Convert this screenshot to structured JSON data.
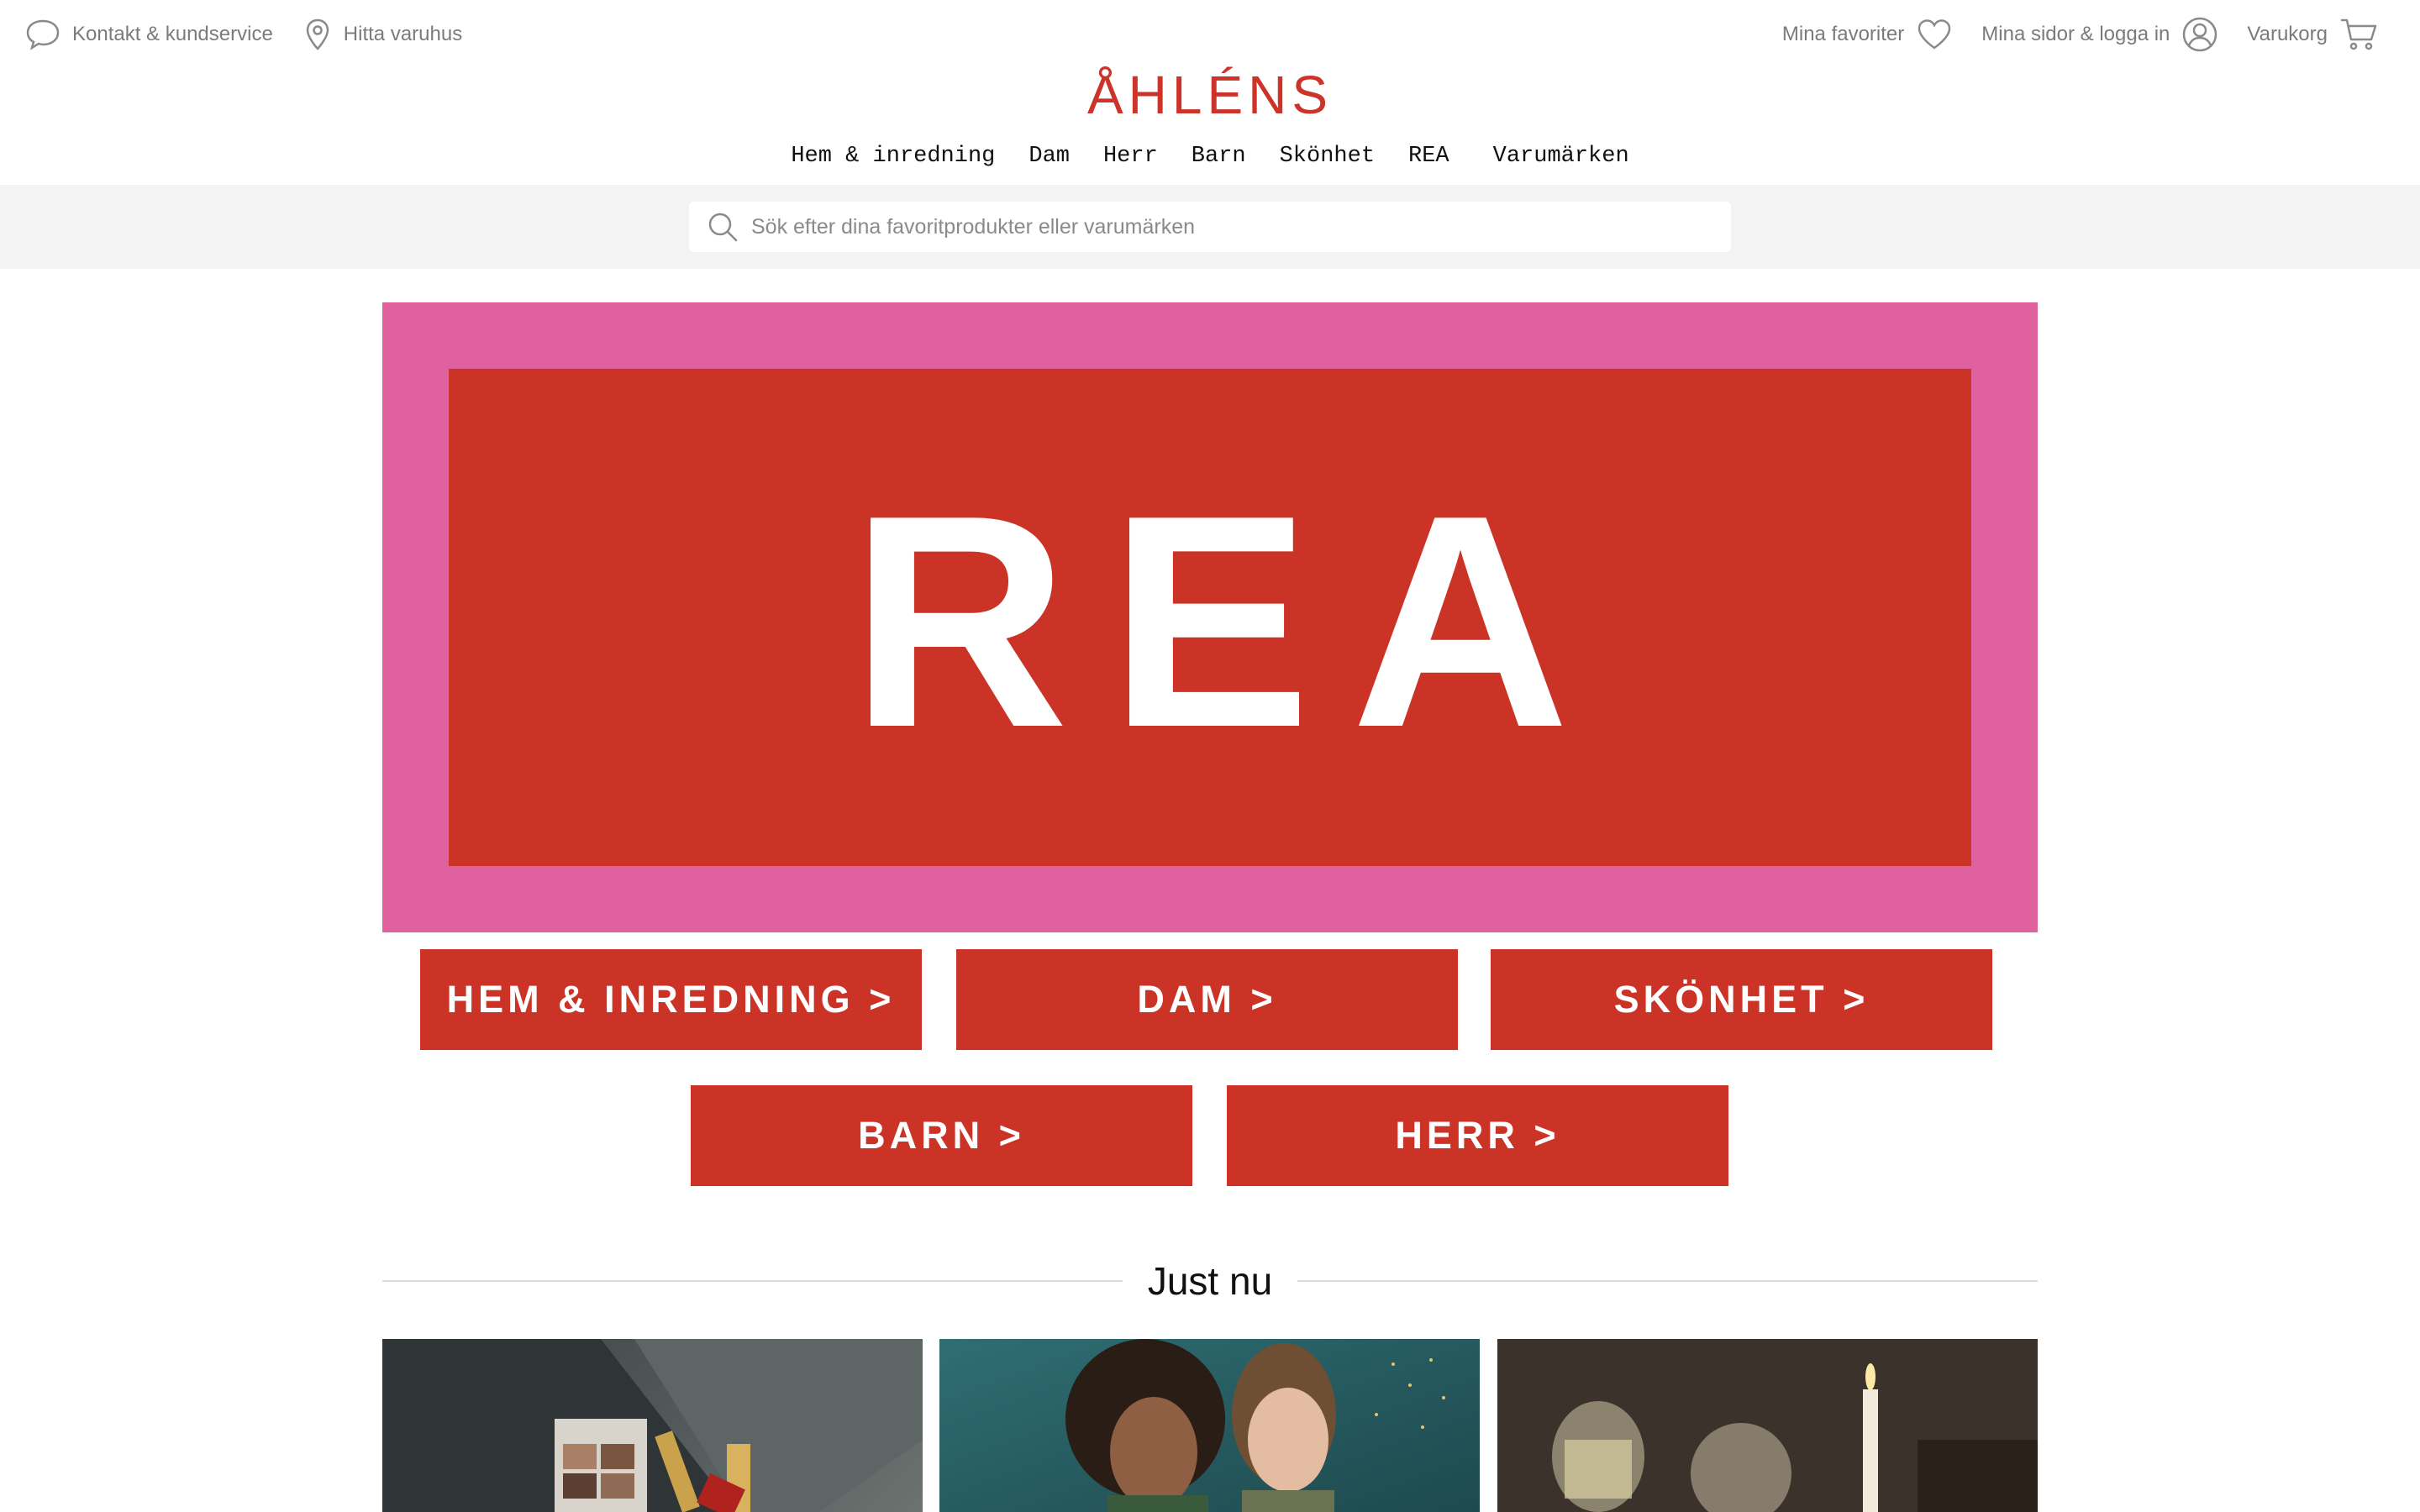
{
  "header": {
    "contact_label": "Kontakt & kundservice",
    "stores_label": "Hitta varuhus",
    "favorites_label": "Mina favoriter",
    "account_label": "Mina sidor & logga in",
    "cart_label": "Varukorg"
  },
  "logo": {
    "text": "ÅHLÉNS",
    "color": "#cc3329"
  },
  "nav": {
    "items": [
      "Hem & inredning",
      "Dam",
      "Herr",
      "Barn",
      "Skönhet",
      "REA",
      "Varumärken"
    ]
  },
  "search": {
    "placeholder": "Sök efter dina favoritprodukter eller varumärken"
  },
  "hero": {
    "text": "REA",
    "outer_color": "#df619d",
    "inner_color": "#cc3327"
  },
  "categories": [
    "HEM & INREDNING >",
    "DAM >",
    "SKÖNHET >",
    "BARN >",
    "HERR >"
  ],
  "section": {
    "title": "Just nu"
  },
  "tiles": [
    {
      "subject": "makeup-products"
    },
    {
      "subject": "fashion-models"
    },
    {
      "subject": "wine-glasses-candle"
    }
  ],
  "icons": {
    "contact": "speech-bubble-icon",
    "stores": "location-pin-icon",
    "favorites": "heart-icon",
    "account": "user-icon",
    "cart": "cart-icon",
    "search": "search-icon"
  }
}
